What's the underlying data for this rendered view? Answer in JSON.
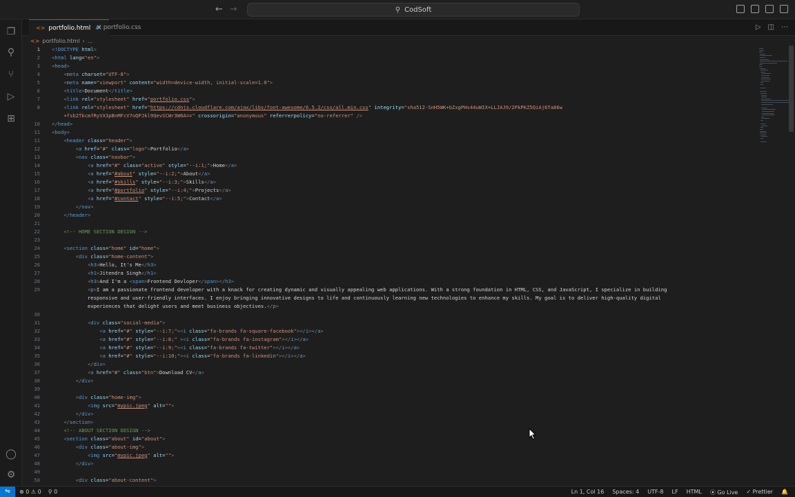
{
  "titlebar": {
    "search_label": "CodSoft",
    "back_glyph": "←",
    "forward_glyph": "→"
  },
  "tabs": [
    {
      "label": "portfolio.html",
      "icon": "html-file-icon",
      "active": true
    },
    {
      "label": "portfolio.css",
      "icon": "css-file-icon",
      "active": false
    }
  ],
  "breadcrumb": {
    "file": "portfolio.html",
    "rest": "..."
  },
  "editor": {
    "current_line": 1,
    "lines": [
      {
        "n": "1",
        "html": "<span class='p'>&lt;</span><span class='t'>!DOCTYPE</span> <span class='a'>html</span><span class='p'>&gt;</span>"
      },
      {
        "n": "2",
        "html": "<span class='p'>&lt;</span><span class='t'>html</span> <span class='a'>lang</span>=<span class='s'>\"en\"</span><span class='p'>&gt;</span>"
      },
      {
        "n": "3",
        "html": "<span class='p'>&lt;</span><span class='t'>head</span><span class='p'>&gt;</span>"
      },
      {
        "n": "4",
        "html": "    <span class='p'>&lt;</span><span class='t'>meta</span> <span class='a'>charset</span>=<span class='s'>\"UTF-8\"</span><span class='p'>&gt;</span>"
      },
      {
        "n": "5",
        "html": "    <span class='p'>&lt;</span><span class='t'>meta</span> <span class='a'>name</span>=<span class='s'>\"viewport\"</span> <span class='a'>content</span>=<span class='s'>\"width=device-width, initial-scale=1.0\"</span><span class='p'>&gt;</span>"
      },
      {
        "n": "6",
        "html": "    <span class='p'>&lt;</span><span class='t'>title</span><span class='p'>&gt;</span>Document<span class='p'>&lt;/</span><span class='t'>title</span><span class='p'>&gt;</span>"
      },
      {
        "n": "7",
        "html": "    <span class='p'>&lt;</span><span class='t'>link</span> <span class='a'>rel</span>=<span class='s'>\"stylesheet\"</span> <span class='a'>href</span>=<span class='s'>\"</span><span class='u'>portfolio.css</span><span class='s'>\"</span><span class='p'>&gt;</span>"
      },
      {
        "n": "8",
        "html": "    <span class='p'>&lt;</span><span class='t'>link</span> <span class='a'>rel</span>=<span class='s'>\"stylesheet\"</span> <span class='a'>href</span>=<span class='s'>\"</span><span class='u'>https://cdnjs.cloudflare.com/ajax/libs/font-awesome/6.5.2/css/all.min.css</span><span class='s'>\"</span> <span class='a'>integrity</span>=<span class='s'>\"sha512-SnH5WK+bZxgPHs44uWIX+LLJAJ9/2PkPKZ5QiAj6Ta86w</span>"
      },
      {
        "n": "",
        "html": "    <span class='s'>+fsb2TkcmfRyVX3pBnMFcV7oQPJkl9QevSCWr3W6A==\"</span> <span class='a'>crossorigin</span>=<span class='s'>\"anonymous\"</span> <span class='a'>referrerpolicy</span>=<span class='s'>\"no-referrer\"</span> <span class='p'>/&gt;</span>"
      },
      {
        "n": "10",
        "html": "<span class='p'>&lt;/</span><span class='t'>head</span><span class='p'>&gt;</span>"
      },
      {
        "n": "11",
        "html": "<span class='p'>&lt;</span><span class='t'>body</span><span class='p'>&gt;</span>"
      },
      {
        "n": "11",
        "html": "    <span class='p'>&lt;</span><span class='t'>header</span> <span class='a'>class</span>=<span class='s'>\"header\"</span><span class='p'>&gt;</span>"
      },
      {
        "n": "12",
        "html": "        <span class='p'>&lt;</span><span class='t'>a</span> <span class='a'>href</span>=<span class='s'>\"#\"</span> <span class='a'>class</span>=<span class='s'>\"logo\"</span><span class='p'>&gt;</span>Portfolio<span class='p'>&lt;/</span><span class='t'>a</span><span class='p'>&gt;</span>"
      },
      {
        "n": "13",
        "html": "        <span class='p'>&lt;</span><span class='t'>nav</span> <span class='a'>class</span>=<span class='s'>\"navbar\"</span><span class='p'>&gt;</span>"
      },
      {
        "n": "14",
        "html": "            <span class='p'>&lt;</span><span class='t'>a</span> <span class='a'>href</span>=<span class='s'>\"#\"</span> <span class='a'>class</span>=<span class='s'>\"active\"</span> <span class='a'>style</span>=<span class='s'>\"--i:1;\"</span><span class='p'>&gt;</span>Home<span class='p'>&lt;/</span><span class='t'>a</span><span class='p'>&gt;</span>"
      },
      {
        "n": "15",
        "html": "            <span class='p'>&lt;</span><span class='t'>a</span> <span class='a'>href</span>=<span class='s'>\"</span><span class='u'>#about</span><span class='s'>\"</span> <span class='a'>style</span>=<span class='s'>\"--i:2;\"</span><span class='p'>&gt;</span>About<span class='p'>&lt;/</span><span class='t'>a</span><span class='p'>&gt;</span>"
      },
      {
        "n": "16",
        "html": "            <span class='p'>&lt;</span><span class='t'>a</span> <span class='a'>href</span>=<span class='s'>\"</span><span class='u'>#skills</span><span class='s'>\"</span> <span class='a'>style</span>=<span class='s'>\"--i:3;\"</span><span class='p'>&gt;</span>Skills<span class='p'>&lt;/</span><span class='t'>a</span><span class='p'>&gt;</span>"
      },
      {
        "n": "17",
        "html": "            <span class='p'>&lt;</span><span class='t'>a</span> <span class='a'>href</span>=<span class='s'>\"</span><span class='u'>#portfolio</span><span class='s'>\"</span> <span class='a'>style</span>=<span class='s'>\"--i:4;\"</span><span class='p'>&gt;</span>Projects<span class='p'>&lt;/</span><span class='t'>a</span><span class='p'>&gt;</span>"
      },
      {
        "n": "18",
        "html": "            <span class='p'>&lt;</span><span class='t'>a</span> <span class='a'>href</span>=<span class='s'>\"</span><span class='u'>#contact</span><span class='s'>\"</span> <span class='a'>style</span>=<span class='s'>\"--i:5;\"</span><span class='p'>&gt;</span>Contact<span class='p'>&lt;/</span><span class='t'>a</span><span class='p'>&gt;</span>"
      },
      {
        "n": "19",
        "html": "        <span class='p'>&lt;/</span><span class='t'>nav</span><span class='p'>&gt;</span>"
      },
      {
        "n": "20",
        "html": "    <span class='p'>&lt;/</span><span class='t'>header</span><span class='p'>&gt;</span>"
      },
      {
        "n": "21",
        "html": ""
      },
      {
        "n": "22",
        "html": "    <span class='c'>&lt;!-- HOME SECTION DESIGN --&gt;</span>"
      },
      {
        "n": "23",
        "html": ""
      },
      {
        "n": "24",
        "html": "    <span class='p'>&lt;</span><span class='t'>section</span> <span class='a'>class</span>=<span class='s'>\"home\"</span> <span class='a'>id</span>=<span class='s'>\"home\"</span><span class='p'>&gt;</span>"
      },
      {
        "n": "25",
        "html": "        <span class='p'>&lt;</span><span class='t'>div</span> <span class='a'>class</span>=<span class='s'>\"home-content\"</span><span class='p'>&gt;</span>"
      },
      {
        "n": "26",
        "html": "            <span class='p'>&lt;</span><span class='t'>h3</span><span class='p'>&gt;</span>Hello, It's Me<span class='p'>&lt;/</span><span class='t'>h3</span><span class='p'>&gt;</span>"
      },
      {
        "n": "27",
        "html": "            <span class='p'>&lt;</span><span class='t'>h1</span><span class='p'>&gt;</span>Jitendra Singh<span class='p'>&lt;/</span><span class='t'>h1</span><span class='p'>&gt;</span>"
      },
      {
        "n": "28",
        "html": "            <span class='p'>&lt;</span><span class='t'>h3</span><span class='p'>&gt;</span>And I'm a <span class='p'>&lt;</span><span class='t'>span</span><span class='p'>&gt;</span>Frontend Devloper<span class='p'>&lt;/</span><span class='t'>span</span><span class='p'>&gt;&lt;/</span><span class='t'>h3</span><span class='p'>&gt;</span>"
      },
      {
        "n": "29",
        "html": "            <span class='p'>&lt;</span><span class='t'>p</span><span class='p'>&gt;</span>I am a passionate frontend developer with a knack for creating dynamic and visually appealing web applications. With a strong foundation in HTML, CSS, and JavaScript, I specialize in building"
      },
      {
        "n": "",
        "html": "            responsive and user-friendly interfaces. I enjoy bringing innovative designs to life and continuously learning new technologies to enhance my skills. My goal is to deliver high-quality digital"
      },
      {
        "n": "",
        "html": "            experiences that delight users and meet business objectives.<span class='p'>&lt;/</span><span class='t'>p</span><span class='p'>&gt;</span>"
      },
      {
        "n": "30",
        "html": ""
      },
      {
        "n": "31",
        "html": "            <span class='p'>&lt;</span><span class='t'>div</span> <span class='a'>class</span>=<span class='s'>\"social-media\"</span><span class='p'>&gt;</span>"
      },
      {
        "n": "32",
        "html": "                <span class='p'>&lt;</span><span class='t'>a</span> <span class='a'>href</span>=<span class='s'>\"#\"</span> <span class='a'>style</span>=<span class='s'>\"--i:7;\"</span><span class='p'>&gt;&lt;</span><span class='t'>i</span> <span class='a'>class</span>=<span class='s'>\"fa-brands fa-square-facebook\"</span><span class='p'>&gt;&lt;/</span><span class='t'>i</span><span class='p'>&gt;&lt;/</span><span class='t'>a</span><span class='p'>&gt;</span>"
      },
      {
        "n": "33",
        "html": "                <span class='p'>&lt;</span><span class='t'>a</span> <span class='a'>href</span>=<span class='s'>\"#\"</span> <span class='a'>style</span>=<span class='s'>\"--i:8;\"</span> <span class='p'>&gt;&lt;</span><span class='t'>i</span> <span class='a'>class</span>=<span class='s'>\"fa-brands fa-instagram\"</span><span class='p'>&gt;&lt;/</span><span class='t'>i</span><span class='p'>&gt;&lt;/</span><span class='t'>a</span><span class='p'>&gt;</span>"
      },
      {
        "n": "34",
        "html": "                <span class='p'>&lt;</span><span class='t'>a</span> <span class='a'>href</span>=<span class='s'>\"#\"</span> <span class='a'>style</span>=<span class='s'>\"--i:9;\"</span><span class='p'>&gt;&lt;</span><span class='t'>i</span> <span class='a'>class</span>=<span class='s'>\"fa-brands fa-twitter\"</span><span class='p'>&gt;&lt;/</span><span class='t'>i</span><span class='p'>&gt;&lt;/</span><span class='t'>a</span><span class='p'>&gt;</span>"
      },
      {
        "n": "35",
        "html": "                <span class='p'>&lt;</span><span class='t'>a</span> <span class='a'>href</span>=<span class='s'>\"#\"</span> <span class='a'>style</span>=<span class='s'>\"--i:10;\"</span><span class='p'>&gt;&lt;</span><span class='t'>i</span> <span class='a'>class</span>=<span class='s'>\"fa-brands fa-linkedin\"</span><span class='p'>&gt;&lt;/</span><span class='t'>i</span><span class='p'>&gt;&lt;/</span><span class='t'>a</span><span class='p'>&gt;</span>"
      },
      {
        "n": "36",
        "html": "            <span class='p'>&lt;/</span><span class='t'>div</span><span class='p'>&gt;</span>"
      },
      {
        "n": "37",
        "html": "            <span class='p'>&lt;</span><span class='t'>a</span> <span class='a'>href</span>=<span class='s'>\"#\"</span> <span class='a'>class</span>=<span class='s'>\"btn\"</span><span class='p'>&gt;</span>Download CV<span class='p'>&lt;/</span><span class='t'>a</span><span class='p'>&gt;</span>"
      },
      {
        "n": "38",
        "html": "        <span class='p'>&lt;/</span><span class='t'>div</span><span class='p'>&gt;</span>"
      },
      {
        "n": "39",
        "html": ""
      },
      {
        "n": "40",
        "html": "        <span class='p'>&lt;</span><span class='t'>div</span> <span class='a'>class</span>=<span class='s'>\"home-img\"</span><span class='p'>&gt;</span>"
      },
      {
        "n": "41",
        "html": "            <span class='p'>&lt;</span><span class='t'>img</span> <span class='a'>src</span>=<span class='s'>\"</span><span class='u'>mypic.jpeg</span><span class='s'>\"</span> <span class='a'>alt</span>=<span class='s'>\"\"</span><span class='p'>&gt;</span>"
      },
      {
        "n": "42",
        "html": "        <span class='p'>&lt;/</span><span class='t'>div</span><span class='p'>&gt;</span>"
      },
      {
        "n": "43",
        "html": "    <span class='p'>&lt;/</span><span class='t'>section</span><span class='p'>&gt;</span>"
      },
      {
        "n": "44",
        "html": "    <span class='c'>&lt;!-- ABOUT SECTION DESIGN --&gt;</span>"
      },
      {
        "n": "45",
        "html": "    <span class='p'>&lt;</span><span class='t'>section</span> <span class='a'>class</span>=<span class='s'>\"about\"</span> <span class='a'>id</span>=<span class='s'>\"about\"</span><span class='p'>&gt;</span>"
      },
      {
        "n": "46",
        "html": "        <span class='p'>&lt;</span><span class='t'>div</span> <span class='a'>class</span>=<span class='s'>\"about-img\"</span><span class='p'>&gt;</span>"
      },
      {
        "n": "47",
        "html": "            <span class='p'>&lt;</span><span class='t'>img</span> <span class='a'>src</span>=<span class='s'>\"</span><span class='u'>mypic.jpeg</span><span class='s'>\"</span> <span class='a'>alt</span>=<span class='s'>\"\"</span><span class='p'>&gt;</span>"
      },
      {
        "n": "48",
        "html": "        <span class='p'>&lt;/</span><span class='t'>div</span><span class='p'>&gt;</span>"
      },
      {
        "n": "49",
        "html": ""
      },
      {
        "n": "50",
        "html": "        <span class='p'>&lt;</span><span class='t'>div</span> <span class='a'>class</span>=<span class='s'>\"about-content\"</span><span class='p'>&gt;</span>"
      }
    ]
  },
  "statusbar": {
    "errors": "⊗ 0 ⚠ 0",
    "ports": "⚲ 0",
    "position": "Ln 1, Col 16",
    "spaces": "Spaces: 4",
    "encoding": "UTF-8",
    "eol": "LF",
    "language": "HTML",
    "golive": "⦿ Go Live",
    "prettier": "✓ Prettier",
    "bell": "🔔"
  },
  "colors": {
    "accent": "#0078d4",
    "background": "#1e1e1e"
  }
}
